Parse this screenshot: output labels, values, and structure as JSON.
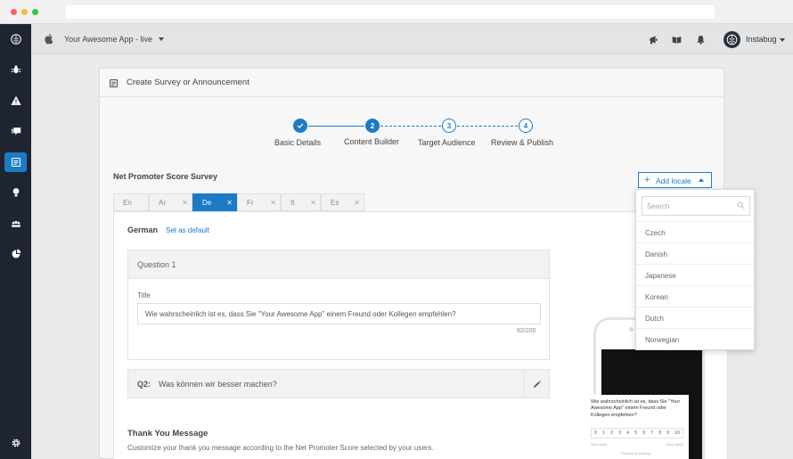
{
  "topbar": {
    "app_name": "Your Awesome App - live",
    "user_name": "Instabug"
  },
  "nav": {
    "items": [
      "logo-icon",
      "bug-icon",
      "warning-icon",
      "chat-icon",
      "survey-icon",
      "feature-request-icon",
      "users-icon",
      "analytics-icon",
      "settings-icon"
    ],
    "active_item": "survey-icon"
  },
  "card": {
    "title": "Create Survey or Announcement"
  },
  "stepper": {
    "steps": [
      {
        "number": "",
        "label": "Basic Details",
        "state": "done"
      },
      {
        "number": "2",
        "label": "Content Builder",
        "state": "active"
      },
      {
        "number": "3",
        "label": "Target Audience",
        "state": "pending"
      },
      {
        "number": "4",
        "label": "Review & Publish",
        "state": "pending"
      }
    ]
  },
  "survey": {
    "name": "Net Promoter Score Survey",
    "add_locale_label": "Add locale"
  },
  "lang_tabs": [
    {
      "code": "En",
      "closable": false
    },
    {
      "code": "Ar",
      "closable": true
    },
    {
      "code": "De",
      "closable": true,
      "active": true
    },
    {
      "code": "Fr",
      "closable": true
    },
    {
      "code": "It",
      "closable": true
    },
    {
      "code": "Es",
      "closable": true
    }
  ],
  "editor": {
    "locale_name": "German",
    "set_default": "Set as default",
    "q1_header": "Question 1",
    "title_label": "Title",
    "title_value": "Wie wahrscheinlich ist es, dass Sie \"Your Awesome App\" einem Freund oder Kollegen empfehlen?",
    "char_count": "92/200",
    "q2_num": "Q2:",
    "q2_text": "Was können wir besser machen?",
    "thank_you_title": "Thank You Message",
    "thank_you_desc": "Customize your thank you message according to the Net Promoter Score selected by your users."
  },
  "phone": {
    "question": "Wie wahrscheinlich ist es, dass Sie \"Your Awesome App\" einem Freund oder Kollegen empfehlen?",
    "scale": [
      "0",
      "1",
      "2",
      "3",
      "4",
      "5",
      "6",
      "7",
      "8",
      "9",
      "10"
    ],
    "low_label": "Not Likely",
    "high_label": "Very Likely",
    "powered": "Powered by Instabug"
  },
  "dropdown": {
    "search_placeholder": "Search",
    "items": [
      "Czech",
      "Danish",
      "Japanese",
      "Korean",
      "Dutch",
      "Norwegian"
    ]
  },
  "colors": {
    "accent": "#1c7bc7",
    "nav_bg": "#1e2431"
  }
}
